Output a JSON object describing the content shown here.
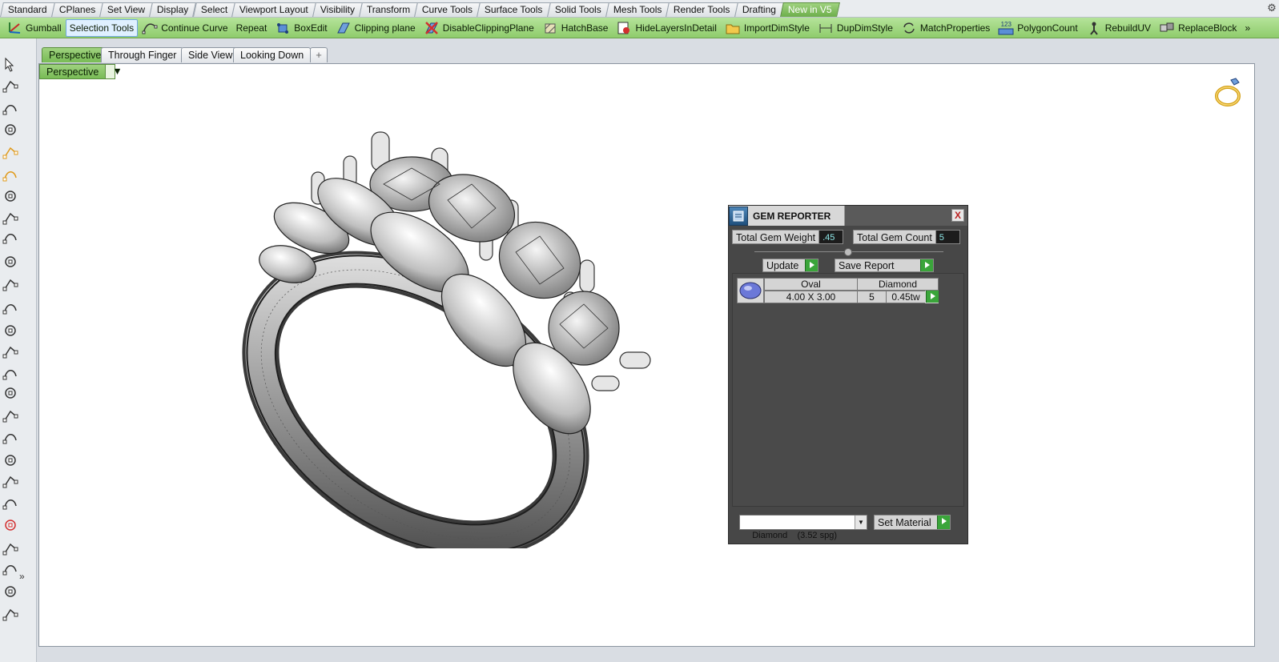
{
  "top_tabs": [
    "Standard",
    "CPlanes",
    "Set View",
    "Display",
    "Select",
    "Viewport Layout",
    "Visibility",
    "Transform",
    "Curve Tools",
    "Surface Tools",
    "Solid Tools",
    "Mesh Tools",
    "Render Tools",
    "Drafting",
    "New in V5"
  ],
  "toolbar": {
    "gumball": "Gumball",
    "selection_tools": "Selection Tools",
    "continue_curve": "Continue Curve",
    "repeat": "Repeat",
    "boxedit": "BoxEdit",
    "clipping_plane": "Clipping plane",
    "disable_clipping_plane": "DisableClippingPlane",
    "hatchbase": "HatchBase",
    "hide_layers_in_detail": "HideLayersInDetail",
    "import_dim_style": "ImportDimStyle",
    "dup_dim_style": "DupDimStyle",
    "match_properties": "MatchProperties",
    "polygon_count_icon_text": "123",
    "polygon_count": "PolygonCount",
    "rebuild_uv": "RebuildUV",
    "replace_block": "ReplaceBlock",
    "more": "»"
  },
  "left_toolbar": {
    "more": "»"
  },
  "viewport_tabs": [
    "Perspective",
    "Through Finger",
    "Side View",
    "Looking Down"
  ],
  "viewport_tab_add": "+",
  "viewport": {
    "label": "Perspective",
    "dropdown": "▼"
  },
  "gem_reporter": {
    "title": "GEM REPORTER",
    "close": "X",
    "total_weight_label": "Total Gem Weight",
    "total_weight_value": ".45",
    "total_count_label": "Total Gem Count",
    "total_count_value": "5",
    "update_label": "Update",
    "save_report_label": "Save Report",
    "columns": [
      "Oval",
      "Diamond"
    ],
    "row": {
      "size": "4.00 X 3.00",
      "count": "5",
      "weight": "0.45tw"
    },
    "material_select": "Diamond    (3.52 spg)",
    "select_arrow": "▼",
    "set_material_label": "Set Material"
  },
  "colors": {
    "toolbar_green": "#8fcc6c",
    "active_tab_green": "#6cae4a",
    "panel_dark": "#474747",
    "value_cyan": "#8fe8e8"
  }
}
